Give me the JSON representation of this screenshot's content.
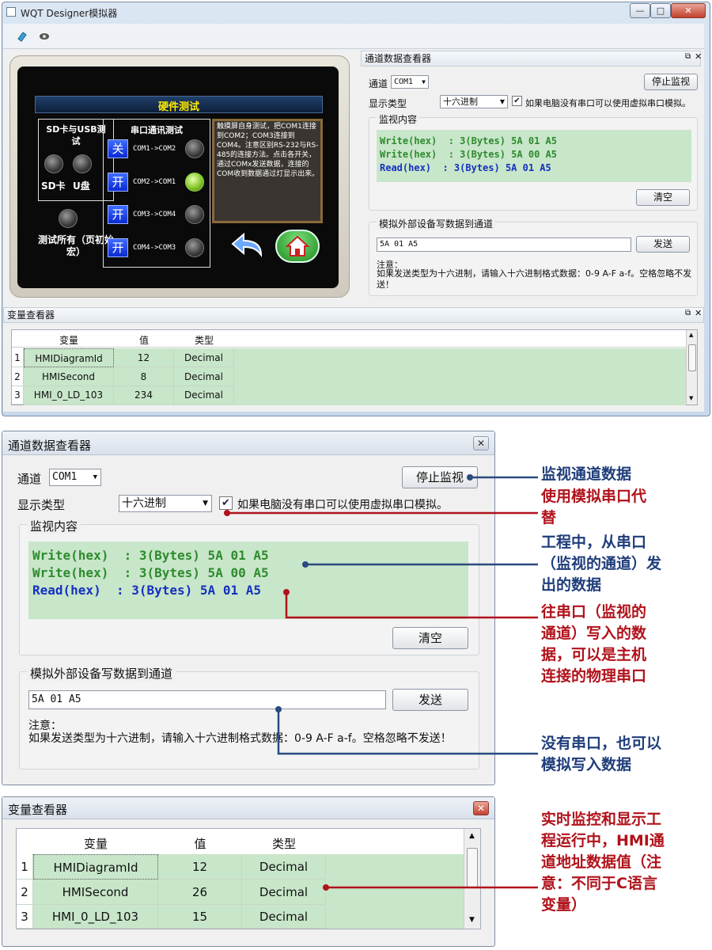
{
  "window": {
    "title": "WQT Designer模拟器",
    "min": "—",
    "max": "□",
    "close": "✕"
  },
  "preview": {
    "header": "硬件测试",
    "sd_title": "SD卡与USB测试",
    "sd_label": "SD卡",
    "udisk_label": "U盘",
    "test_all": "测试所有（页初始宏）",
    "serial_title": "串口通讯测试",
    "ports": [
      {
        "btn": "关",
        "label": "COM1->COM2"
      },
      {
        "btn": "开",
        "label": "COM2->COM1"
      },
      {
        "btn": "开",
        "label": "COM3->COM4"
      },
      {
        "btn": "开",
        "label": "COM4->COM3"
      }
    ],
    "info": "触摸屏自身测试，把COM1连接到COM2；COM3连接到COM4。注意区别RS-232与RS-485的连接方法。点击各开关，通过COMx发送数据，连接的COM收到数据通过灯显示出来。"
  },
  "channel_viewer": {
    "title": "通道数据查看器",
    "channel_label": "通道",
    "channel_value": "COM1",
    "stop_button": "停止监视",
    "display_label": "显示类型",
    "display_value": "十六进制",
    "checkbox_label": "如果电脑没有串口可以使用虚拟串口模拟。",
    "monitor_group": "监视内容",
    "lines": [
      {
        "text": "Write(hex)  : 3(Bytes) 5A 01 A5",
        "color": "#2e8b2e"
      },
      {
        "text": "Write(hex)  : 3(Bytes) 5A 00 A5",
        "color": "#2e8b2e"
      },
      {
        "text": "Read(hex)  : 3(Bytes) 5A 01 A5",
        "color": "#1530c0"
      }
    ],
    "clear_button": "清空",
    "simulate_group": "模拟外部设备写数据到通道",
    "send_value": "5A 01 A5",
    "send_button": "发送",
    "note_title": "注意：",
    "note_text": "如果发送类型为十六进制，请输入十六进制格式数据：0-9 A-F a-f。空格忽略不发送！"
  },
  "variable_viewer": {
    "title": "变量查看器",
    "columns": [
      "变量",
      "值",
      "类型"
    ],
    "rows_top": [
      {
        "n": "1",
        "name": "HMIDiagramId",
        "value": "12",
        "type": "Decimal"
      },
      {
        "n": "2",
        "name": "HMISecond",
        "value": "8",
        "type": "Decimal"
      },
      {
        "n": "3",
        "name": "HMI_0_LD_103",
        "value": "234",
        "type": "Decimal"
      }
    ],
    "rows_bottom": [
      {
        "n": "1",
        "name": "HMIDiagramId",
        "value": "12",
        "type": "Decimal"
      },
      {
        "n": "2",
        "name": "HMISecond",
        "value": "26",
        "type": "Decimal"
      },
      {
        "n": "3",
        "name": "HMI_0_LD_103",
        "value": "15",
        "type": "Decimal"
      }
    ]
  },
  "annotations": [
    {
      "text": "监视通道数据",
      "color": "#1f3d7a"
    },
    {
      "text": "使用模拟串口代替",
      "color": "#b0121b"
    },
    {
      "text": "工程中，从串口（监视的通道）发出的数据",
      "color": "#1f3d7a"
    },
    {
      "text": "往串口（监视的通道）写入的数据，可以是主机连接的物理串口",
      "color": "#b0121b"
    },
    {
      "text": "没有串口，也可以模拟写入数据",
      "color": "#1f3d7a"
    },
    {
      "text": "实时监控和显示工程运行中，HMI通道地址数据值（注意：不同于C语言变量）",
      "color": "#b0121b"
    }
  ]
}
